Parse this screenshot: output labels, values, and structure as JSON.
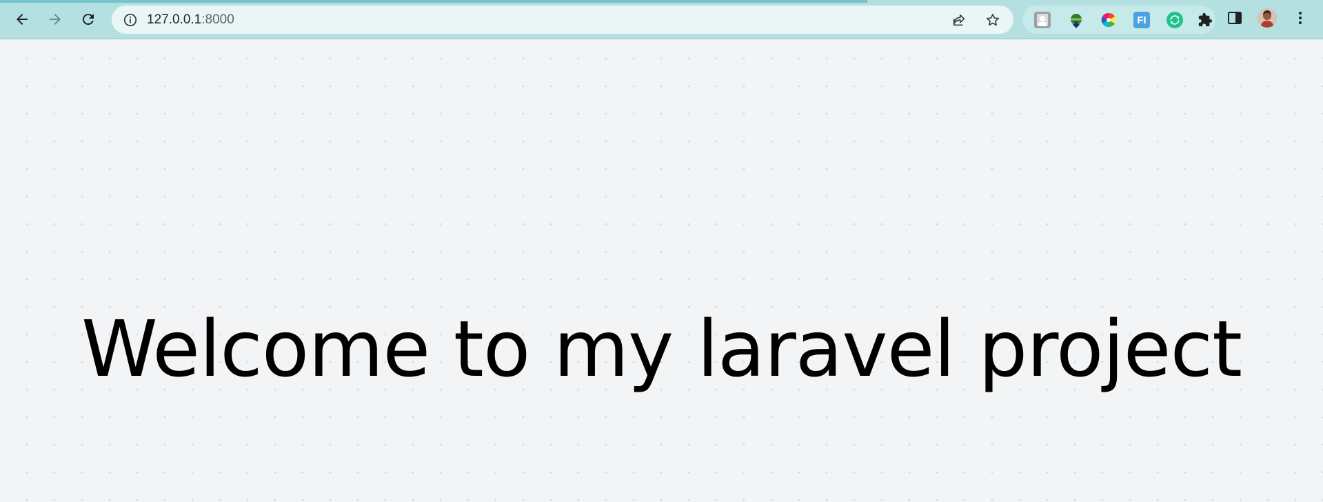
{
  "browser": {
    "url_host": "127.0.0.1",
    "url_port": ":8000",
    "toolbar_color": "#b4e0e2",
    "icons": {
      "back": "arrow-left-icon",
      "forward": "arrow-right-icon",
      "reload": "reload-icon",
      "site_info": "info-icon",
      "share": "share-icon",
      "bookmark": "star-icon",
      "extensions": "puzzle-icon",
      "side_panel": "side-panel-icon",
      "menu": "kebab-menu-icon"
    },
    "extension_icons": [
      "profile-ext-icon",
      "idm-ext-icon",
      "color-wheel-ext-icon",
      "font-ext-icon",
      "sync-ext-icon"
    ],
    "extension_badge_text": "FI"
  },
  "page": {
    "headline": "Welcome to my laravel project",
    "background": "#f3f4f6"
  }
}
